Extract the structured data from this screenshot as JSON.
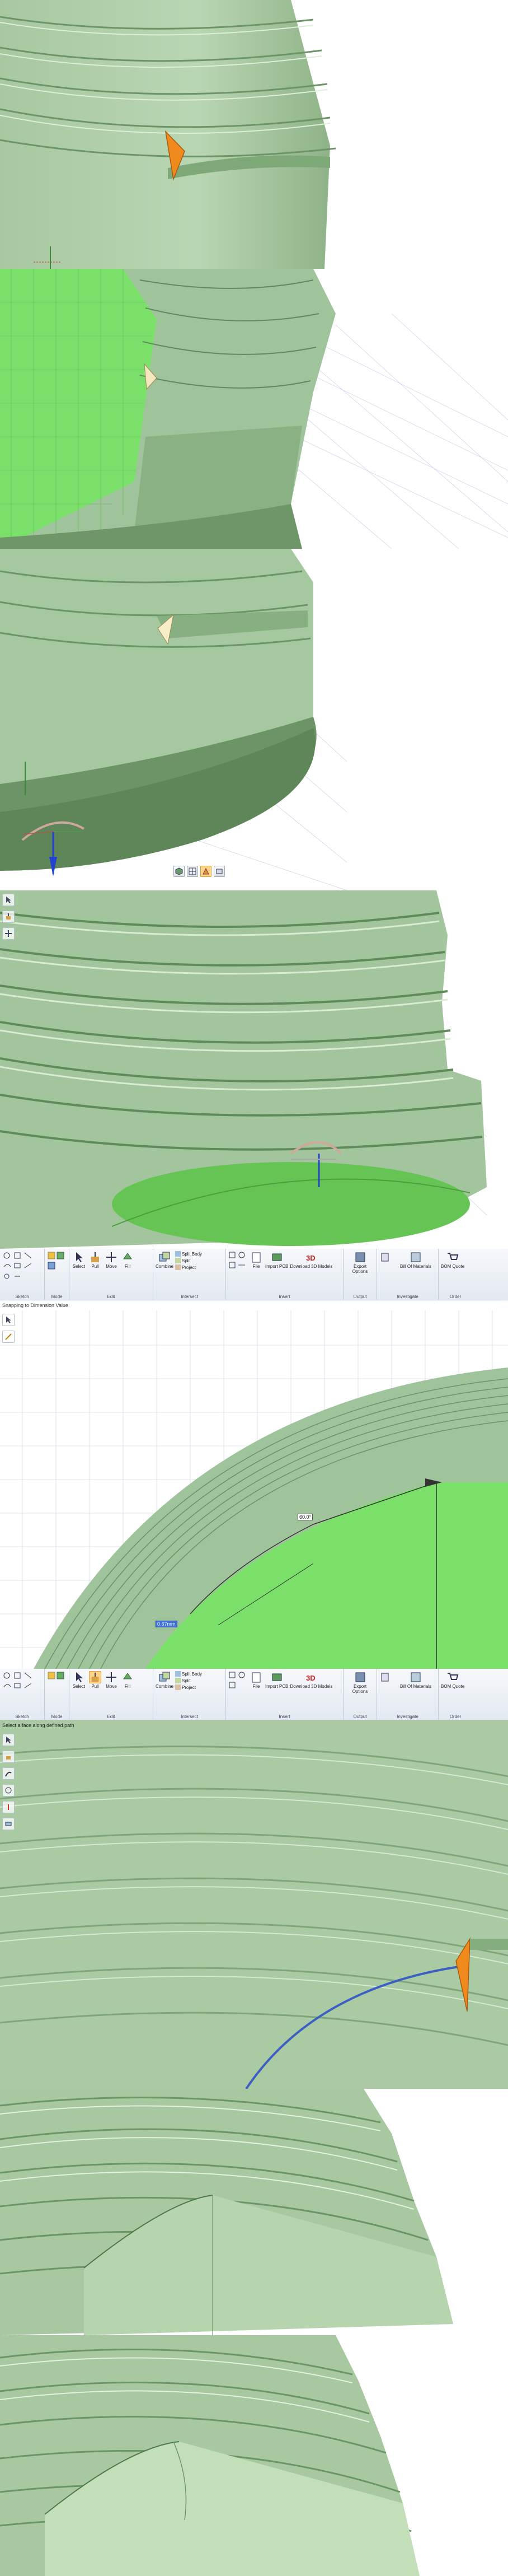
{
  "colors": {
    "body_green": "#a9c9a3",
    "thread_dark": "#5f8a62",
    "thread_light": "#cfe6c8",
    "selected_face": "#7be06a",
    "accent_orange": "#f08a1c",
    "path_blue": "#3d5fc4",
    "grid_lines": "#c9cdef"
  },
  "panel3": {
    "mini_toolbar_icons": [
      "view-cube-icon",
      "grid-icon",
      "section-icon",
      "clip-icon"
    ]
  },
  "panel4": {
    "side_tool_icons": [
      "select-tool-icon",
      "pull-tool-icon",
      "move-tool-icon"
    ]
  },
  "ribbon1": {
    "groups": [
      {
        "label": "Sketch"
      },
      {
        "label": "Mode"
      },
      {
        "label": "Edit",
        "buttons": [
          "Select",
          "Pull",
          "Move",
          "Fill"
        ]
      },
      {
        "label": "Intersect",
        "big": "Combine",
        "small": [
          "Split Body",
          "Split",
          "Project"
        ]
      },
      {
        "label": "Insert",
        "buttons": [
          "File",
          "Import PCB",
          "Download 3D Models"
        ]
      },
      {
        "label": "Output",
        "buttons": [
          "Export Options"
        ]
      },
      {
        "label": "Investigate",
        "buttons": [
          "Bill Of Materials"
        ]
      },
      {
        "label": "Order",
        "buttons": [
          "BOM Quote"
        ]
      }
    ],
    "status": "Snapping to Dimension Value"
  },
  "panel5": {
    "angle_label": "60.0°",
    "selected_value": "0.67mm"
  },
  "ribbon2": {
    "groups": [
      {
        "label": "Sketch"
      },
      {
        "label": "Mode"
      },
      {
        "label": "Edit",
        "buttons": [
          "Select",
          "Pull",
          "Move",
          "Fill"
        ]
      },
      {
        "label": "Intersect",
        "big": "Combine",
        "small": [
          "Split Body",
          "Split",
          "Project"
        ]
      },
      {
        "label": "Insert",
        "buttons": [
          "File",
          "Import PCB",
          "Download 3D Models"
        ]
      },
      {
        "label": "Output",
        "buttons": [
          "Export Options"
        ]
      },
      {
        "label": "Investigate",
        "buttons": [
          "Bill Of Materials"
        ]
      },
      {
        "label": "Order",
        "buttons": [
          "BOM Quote"
        ]
      }
    ],
    "status": "Select a face along defined path"
  },
  "panel6": {
    "side_tool_icons": [
      "select-tool-icon",
      "pull-tool-icon",
      "sweep-tool-icon",
      "revolve-tool-icon",
      "up-to-tool-icon",
      "full-length-tool-icon"
    ]
  }
}
